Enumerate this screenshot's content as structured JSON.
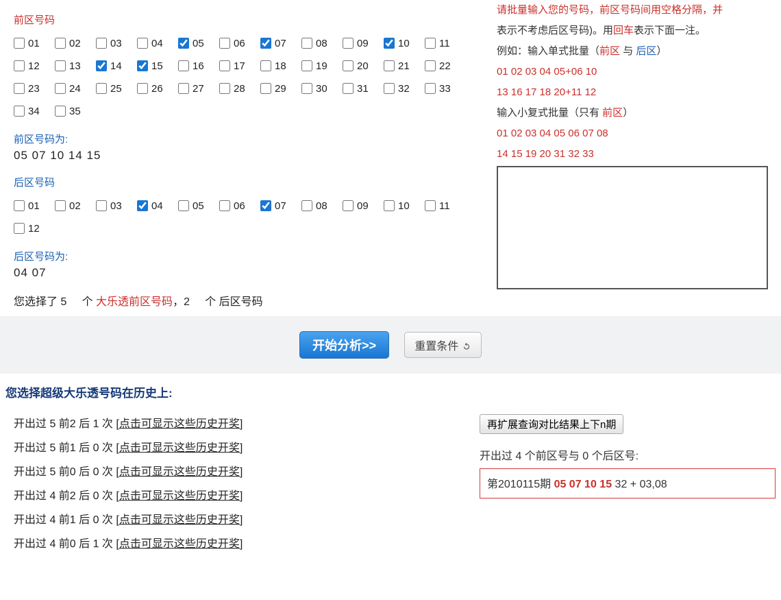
{
  "front": {
    "title": "前区号码",
    "count": 35,
    "checked": [
      5,
      7,
      10,
      14,
      15
    ],
    "picked_label": "前区号码为:",
    "picked_text": "05 07 10 14  15"
  },
  "back": {
    "title": "后区号码",
    "count": 12,
    "checked": [
      4,
      7
    ],
    "picked_label": "后区号码为:",
    "picked_text": "04 07"
  },
  "summary": {
    "prefix": "您选择了 5",
    "mid1": " 个 ",
    "lottery": "大乐透前区号码",
    "sep": "，2",
    "mid2": " 个 后区号码"
  },
  "right": {
    "line1_a": "请批量输入您的号码，",
    "line1_b": "前区号码",
    "line1_c": "间用空格分隔，并",
    "line2_a": "表示不考虑后区号码)。用",
    "line2_b": "回车",
    "line2_c": "表示下面一注。",
    "example_label": "例如：输入单式批量（",
    "front_word": "前区",
    "and_word": " 与 ",
    "back_word": "后区",
    "close_paren": "）",
    "ex1": "01 02 03 04 05+06 10",
    "ex2": "13 16 17 18 20+11 12",
    "small_label_a": "输入小复式批量（只有 ",
    "small_label_b": "前区",
    "small_label_c": "）",
    "ex3": "01 02 03 04 05 06 07 08",
    "ex4": "14 15 19 20 31 32 33",
    "textarea_value": ""
  },
  "actions": {
    "analyze": "开始分析>>",
    "reset": "重置条件",
    "reset_icon": "↻"
  },
  "results": {
    "title": "您选择超级大乐透号码在历史上:",
    "rows": [
      {
        "text": "开出过 5 前2 后 1 次",
        "link": "[点击可显示这些历史开奖]"
      },
      {
        "text": "开出过 5 前1 后 0 次",
        "link": "[点击可显示这些历史开奖]"
      },
      {
        "text": "开出过 5 前0 后 0 次",
        "link": "[点击可显示这些历史开奖]"
      },
      {
        "text": "开出过 4 前2 后 0 次",
        "link": "[点击可显示这些历史开奖]"
      },
      {
        "text": "开出过 4 前1 后 0 次",
        "link": "[点击可显示这些历史开奖]"
      },
      {
        "text": "开出过 4 前0 后 1 次",
        "link": "[点击可显示这些历史开奖]"
      }
    ],
    "extend_btn": "再扩展查询对比结果上下n期",
    "match_title": "开出过 4 个前区号与 0 个后区号:",
    "match_prefix": "第2010115期 ",
    "match_red": "05 07 10 15",
    "match_suffix": " 32 + 03,08"
  }
}
